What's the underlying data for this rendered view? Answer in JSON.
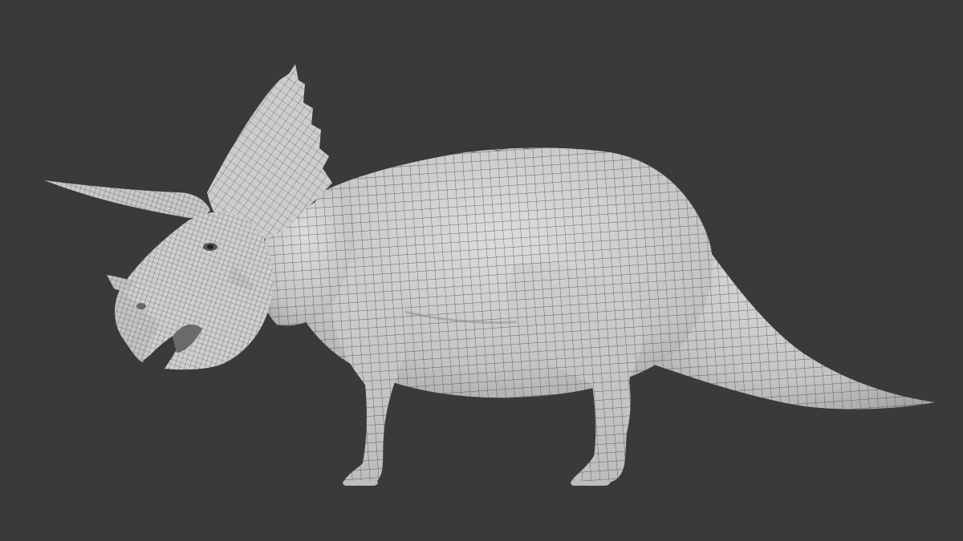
{
  "scene": {
    "background_color": "#3a3a3a",
    "mesh_fill_color": "#c9c9c9",
    "mesh_shadow_color": "#a9a9a9",
    "mesh_highlight_color": "#dedede",
    "wire_color": "#2a2a2a",
    "subject": "triceratops-wireframe-mesh"
  }
}
